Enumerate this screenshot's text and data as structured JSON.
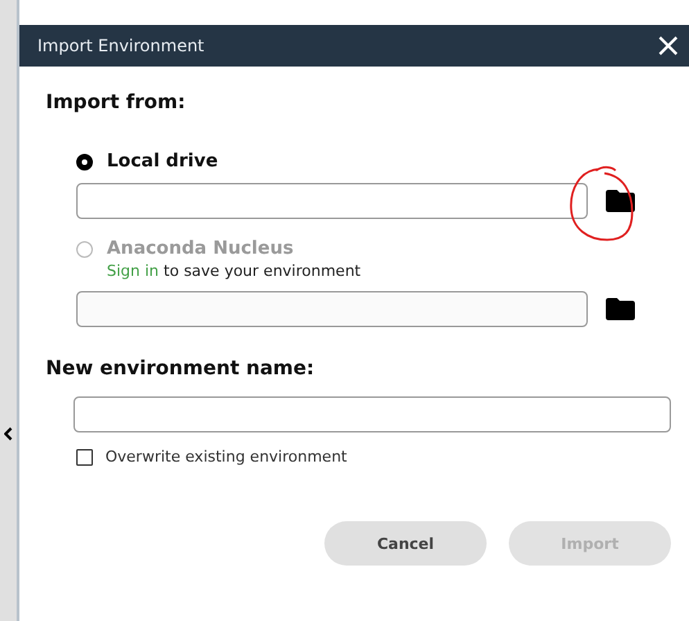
{
  "dialog": {
    "title": "Import Environment"
  },
  "import_from": {
    "heading": "Import from:",
    "sources": [
      {
        "label": "Local drive",
        "selected": true,
        "disabled": false
      },
      {
        "label": "Anaconda Nucleus",
        "selected": false,
        "disabled": true,
        "note_link": "Sign in",
        "note": "to save your environment"
      }
    ]
  },
  "name_section": {
    "heading": "New environment name:",
    "overwrite": {
      "label": "Overwrite existing environment",
      "checked": false
    }
  },
  "buttons": [
    {
      "label": "Cancel",
      "disabled": false
    },
    {
      "label": "Import",
      "disabled": true
    }
  ]
}
